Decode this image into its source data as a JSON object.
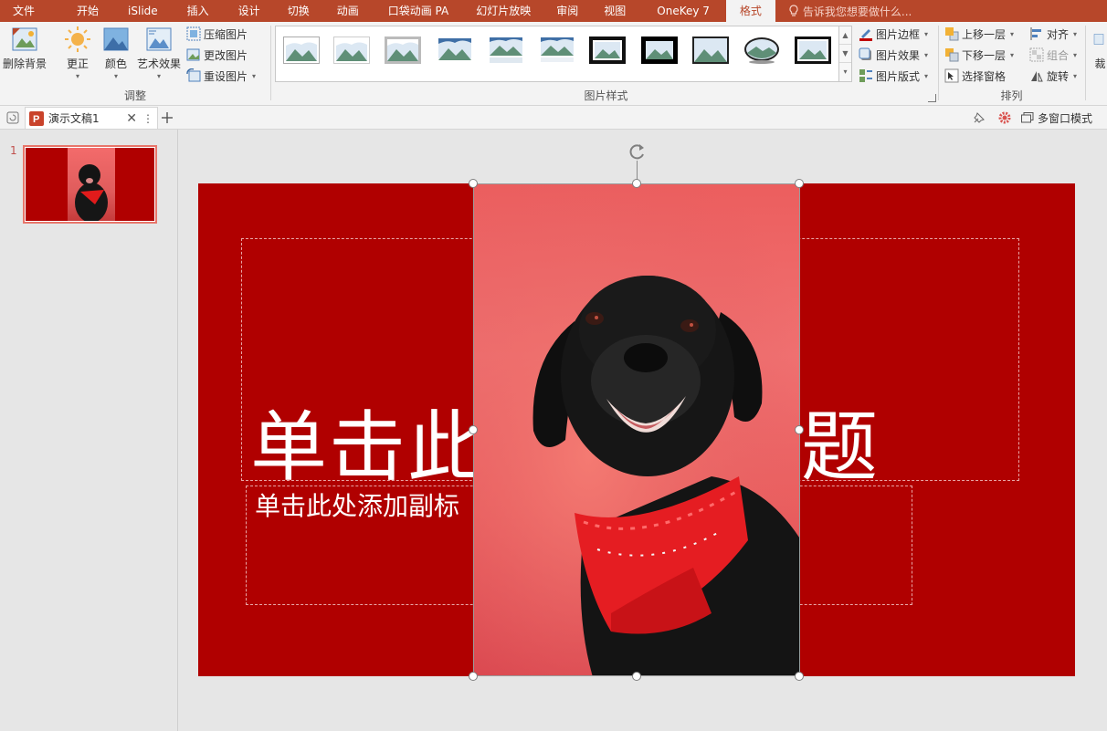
{
  "menu": {
    "tabs": [
      "文件",
      "开始",
      "iSlide",
      "插入",
      "设计",
      "切换",
      "动画",
      "口袋动画 PA",
      "幻灯片放映",
      "审阅",
      "视图",
      "OneKey 7",
      "格式"
    ],
    "active_tab": "格式",
    "tell_me": "告诉我您想要做什么..."
  },
  "ribbon": {
    "remove_bg": "删除背景",
    "corrections": "更正",
    "color": "颜色",
    "artistic": "艺术效果",
    "compress": "压缩图片",
    "change_pic": "更改图片",
    "reset_pic": "重设图片",
    "adjust_label": "调整",
    "pic_styles_label": "图片样式",
    "pic_border": "图片边框",
    "pic_effects": "图片效果",
    "pic_layout": "图片版式",
    "bring_forward": "上移一层",
    "send_backward": "下移一层",
    "selection_pane": "选择窗格",
    "align": "对齐",
    "group": "组合",
    "rotate": "旋转",
    "arrange_label": "排列",
    "crop": "裁"
  },
  "colors": {
    "accent": "#b7472a",
    "slide_bg": "#b00000"
  },
  "tabstrip": {
    "doc_title": "演示文稿1",
    "window_mode": "多窗口模式"
  },
  "thumbnail": {
    "number": "1"
  },
  "slide": {
    "title_left": "单击此",
    "title_right": "题",
    "subtitle": "单击此处添加副标"
  }
}
